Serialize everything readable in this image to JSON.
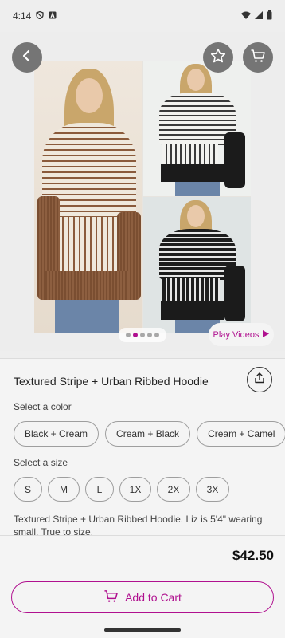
{
  "status_bar": {
    "time": "4:14"
  },
  "gallery": {
    "dot_count": 5,
    "active_index": 1,
    "play_videos_label": "Play Videos"
  },
  "product": {
    "title": "Textured Stripe + Urban Ribbed Hoodie",
    "description": "Textured Stripe + Urban Ribbed Hoodie. Liz is 5'4\" wearing small. True to size.",
    "price": "$42.50"
  },
  "color_section": {
    "label": "Select a color",
    "options": [
      "Black + Cream",
      "Cream + Black",
      "Cream + Camel"
    ]
  },
  "size_section": {
    "label": "Select a size",
    "options": [
      "S",
      "M",
      "L",
      "1X",
      "2X",
      "3X"
    ]
  },
  "actions": {
    "add_to_cart_label": "Add to Cart"
  },
  "colors": {
    "accent": "#b0108f",
    "button_gray": "#757575"
  }
}
